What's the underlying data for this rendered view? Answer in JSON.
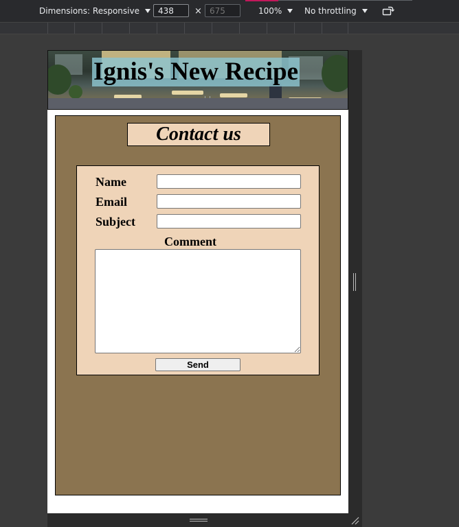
{
  "devtools": {
    "dimensions_label": "Dimensions: Responsive",
    "width_value": "438",
    "height_placeholder": "675",
    "times_glyph": "×",
    "zoom_label": "100%",
    "throttling_label": "No throttling",
    "rotate_icon": "rotate-icon"
  },
  "page": {
    "banner_title": "Ignis's New Recipe",
    "heading": "Contact us",
    "form": {
      "name_label": "Name",
      "email_label": "Email",
      "subject_label": "Subject",
      "comment_label": "Comment",
      "name_value": "",
      "email_value": "",
      "subject_value": "",
      "comment_value": "",
      "send_label": "Send"
    }
  },
  "colors": {
    "content_background": "#8b7450",
    "form_background": "#efd4b8",
    "title_highlight": "#8cc4d0",
    "devtools_background": "#292a2d"
  }
}
